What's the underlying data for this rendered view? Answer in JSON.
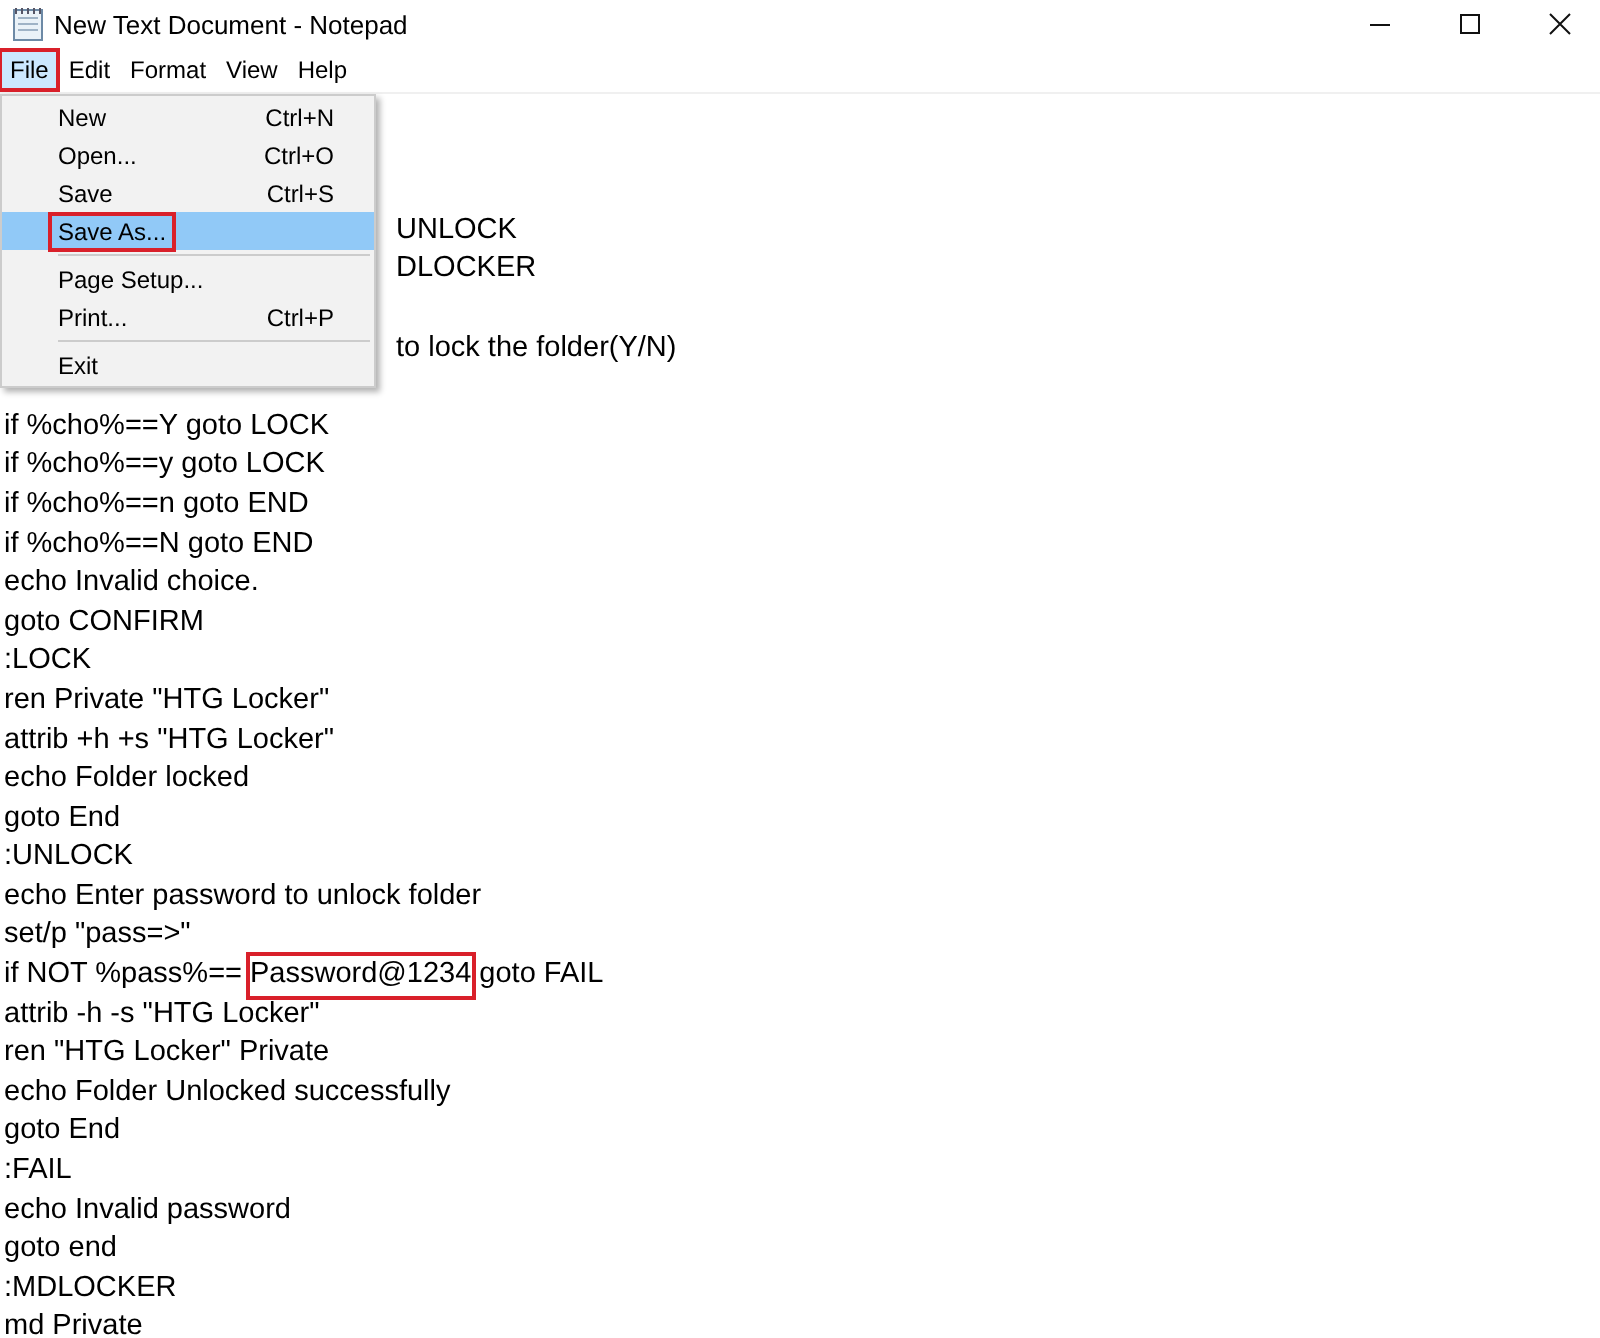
{
  "window": {
    "title": "New Text Document - Notepad"
  },
  "menu_bar": [
    {
      "label": "File",
      "selected": true,
      "annotated": true
    },
    {
      "label": "Edit",
      "selected": false,
      "annotated": false
    },
    {
      "label": "Format",
      "selected": false,
      "annotated": false
    },
    {
      "label": "View",
      "selected": false,
      "annotated": false
    },
    {
      "label": "Help",
      "selected": false,
      "annotated": false
    }
  ],
  "file_menu": [
    {
      "kind": "item",
      "label": "New",
      "shortcut": "Ctrl+N",
      "selected": false,
      "annotated": false
    },
    {
      "kind": "item",
      "label": "Open...",
      "shortcut": "Ctrl+O",
      "selected": false,
      "annotated": false
    },
    {
      "kind": "item",
      "label": "Save",
      "shortcut": "Ctrl+S",
      "selected": false,
      "annotated": false
    },
    {
      "kind": "item",
      "label": "Save As...",
      "selected": true,
      "annotated": true
    },
    {
      "kind": "separator"
    },
    {
      "kind": "item",
      "label": "Page Setup...",
      "selected": false,
      "annotated": false
    },
    {
      "kind": "item",
      "label": "Print...",
      "shortcut": "Ctrl+P",
      "selected": false,
      "annotated": false
    },
    {
      "kind": "separator"
    },
    {
      "kind": "item",
      "label": "Exit",
      "selected": false,
      "annotated": false
    }
  ],
  "editor_lines": [
    {
      "kind": "covered"
    },
    {
      "kind": "covered"
    },
    {
      "kind": "covered"
    },
    {
      "kind": "partial",
      "text": "UNLOCK"
    },
    {
      "kind": "partial",
      "text": "DLOCKER"
    },
    {
      "kind": "covered"
    },
    {
      "kind": "partial",
      "text": "to lock the folder(Y/N)"
    },
    {
      "kind": "covered"
    },
    {
      "kind": "line",
      "text": "if %cho%==Y goto LOCK"
    },
    {
      "kind": "line",
      "text": "if %cho%==y goto LOCK"
    },
    {
      "kind": "line",
      "text": "if %cho%==n goto END"
    },
    {
      "kind": "line",
      "text": "if %cho%==N goto END"
    },
    {
      "kind": "line",
      "text": "echo Invalid choice."
    },
    {
      "kind": "line",
      "text": "goto CONFIRM"
    },
    {
      "kind": "line",
      "text": ":LOCK"
    },
    {
      "kind": "line",
      "text": "ren Private \"HTG Locker\""
    },
    {
      "kind": "line",
      "text": "attrib +h +s \"HTG Locker\""
    },
    {
      "kind": "line",
      "text": "echo Folder locked"
    },
    {
      "kind": "line",
      "text": "goto End"
    },
    {
      "kind": "line",
      "text": ":UNLOCK"
    },
    {
      "kind": "line",
      "text": "echo Enter password to unlock folder"
    },
    {
      "kind": "line",
      "text": "set/p \"pass=>\""
    },
    {
      "kind": "highlighted",
      "before": "if NOT %pass%==",
      "mark": "Password@1234",
      "after": "goto FAIL"
    },
    {
      "kind": "line",
      "text": "attrib -h -s \"HTG Locker\""
    },
    {
      "kind": "line",
      "text": "ren \"HTG Locker\" Private"
    },
    {
      "kind": "line",
      "text": "echo Folder Unlocked successfully"
    },
    {
      "kind": "line",
      "text": "goto End"
    },
    {
      "kind": "line",
      "text": ":FAIL"
    },
    {
      "kind": "line",
      "text": "echo Invalid password"
    },
    {
      "kind": "line",
      "text": "goto end"
    },
    {
      "kind": "line",
      "text": ":MDLOCKER"
    },
    {
      "kind": "line",
      "text": "md Private"
    }
  ]
}
